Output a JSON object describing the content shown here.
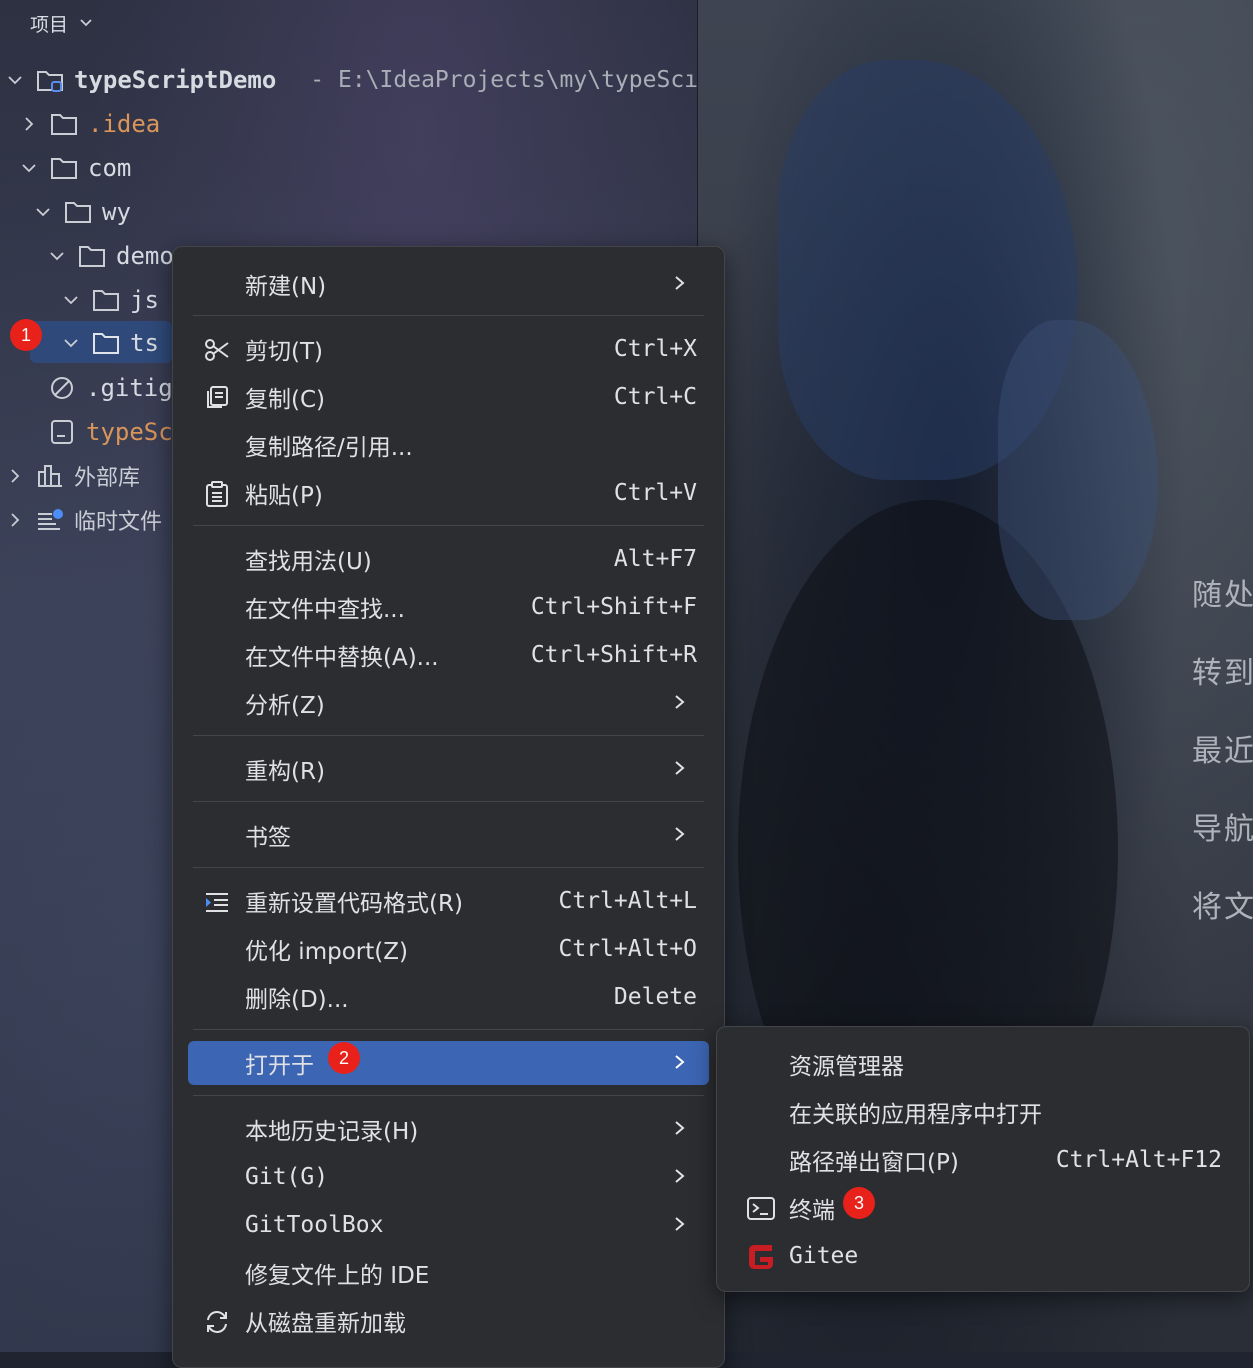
{
  "pane": {
    "title": "项目"
  },
  "tree": [
    {
      "label": "typeScriptDemo",
      "path": "- E:\\IdeaProjects\\my\\typeScı"
    },
    {
      "label": ".idea"
    },
    {
      "label": "com"
    },
    {
      "label": "wy"
    },
    {
      "label": "demo"
    },
    {
      "label": "js"
    },
    {
      "label": "ts"
    },
    {
      "label": ".gitig"
    },
    {
      "label": "typeSc"
    },
    {
      "label": "外部库"
    },
    {
      "label": "临时文件"
    }
  ],
  "badges": [
    "1",
    "2",
    "3"
  ],
  "menu": [
    {
      "label": "新建(N)",
      "shortcut": "",
      "submenu": true
    },
    {
      "label": "剪切(T)",
      "shortcut": "Ctrl+X",
      "icon": "scissors-icon"
    },
    {
      "label": "复制(C)",
      "shortcut": "Ctrl+C",
      "icon": "copy-icon"
    },
    {
      "label": "复制路径/引用...",
      "shortcut": ""
    },
    {
      "label": "粘贴(P)",
      "shortcut": "Ctrl+V",
      "icon": "paste-icon"
    },
    {
      "label": "查找用法(U)",
      "shortcut": "Alt+F7"
    },
    {
      "label": "在文件中查找...",
      "shortcut": "Ctrl+Shift+F"
    },
    {
      "label": "在文件中替换(A)...",
      "shortcut": "Ctrl+Shift+R"
    },
    {
      "label": "分析(Z)",
      "shortcut": "",
      "submenu": true
    },
    {
      "label": "重构(R)",
      "shortcut": "",
      "submenu": true
    },
    {
      "label": "书签",
      "shortcut": "",
      "submenu": true
    },
    {
      "label": "重新设置代码格式(R)",
      "shortcut": "Ctrl+Alt+L",
      "icon": "reformat-icon"
    },
    {
      "label": "优化 import(Z)",
      "shortcut": "Ctrl+Alt+O"
    },
    {
      "label": "删除(D)...",
      "shortcut": "Delete"
    },
    {
      "label": "打开于",
      "shortcut": "",
      "submenu": true,
      "active": true
    },
    {
      "label": "本地历史记录(H)",
      "shortcut": "",
      "submenu": true
    },
    {
      "label": "Git(G)",
      "shortcut": "",
      "submenu": true
    },
    {
      "label": "GitToolBox",
      "shortcut": "",
      "submenu": true
    },
    {
      "label": "修复文件上的 IDE",
      "shortcut": ""
    },
    {
      "label": "从磁盘重新加载",
      "shortcut": "",
      "icon": "reload-icon"
    }
  ],
  "submenu": [
    {
      "label": "资源管理器",
      "shortcut": ""
    },
    {
      "label": "在关联的应用程序中打开",
      "shortcut": ""
    },
    {
      "label": "路径弹出窗口(P)",
      "shortcut": "Ctrl+Alt+F12"
    },
    {
      "label": "终端",
      "shortcut": "",
      "icon": "terminal-icon"
    },
    {
      "label": "Gitee",
      "shortcut": "",
      "icon": "gitee-icon"
    }
  ],
  "hints": [
    "随处",
    "转到",
    "最近",
    "导航",
    "将文"
  ],
  "colors": {
    "accent": "#3c65b3",
    "badge": "#e8211a",
    "gitee": "#c71d23",
    "menu_bg": "#2b2d30"
  }
}
